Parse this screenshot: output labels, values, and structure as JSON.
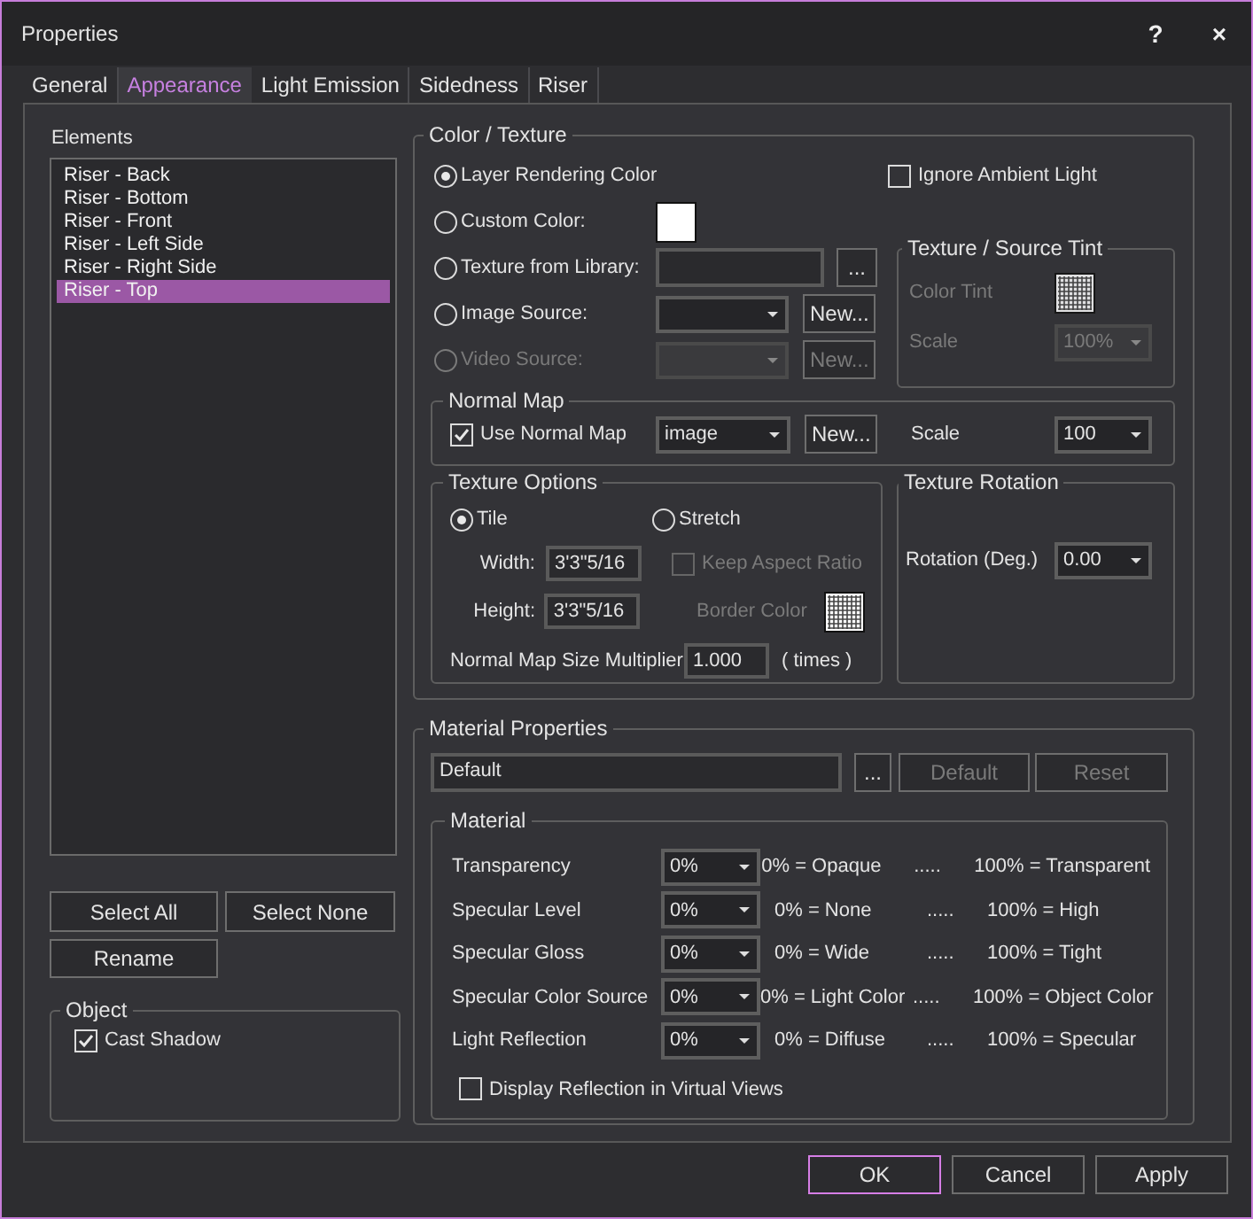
{
  "window": {
    "title": "Properties",
    "help": "?",
    "close": "×"
  },
  "tabs": [
    {
      "label": "General",
      "selected": false
    },
    {
      "label": "Appearance",
      "selected": true
    },
    {
      "label": "Light Emission",
      "selected": false
    },
    {
      "label": "Sidedness",
      "selected": false
    },
    {
      "label": "Riser",
      "selected": false
    }
  ],
  "elements": {
    "title": "Elements",
    "items": [
      {
        "label": "Riser - Back",
        "selected": false
      },
      {
        "label": "Riser - Bottom",
        "selected": false
      },
      {
        "label": "Riser - Front",
        "selected": false
      },
      {
        "label": "Riser - Left Side",
        "selected": false
      },
      {
        "label": "Riser - Right Side",
        "selected": false
      },
      {
        "label": "Riser - Top",
        "selected": true
      }
    ],
    "buttons": [
      "Select All",
      "Select None",
      "Rename"
    ]
  },
  "object": {
    "title": "Object",
    "cast_shadow": {
      "label": "Cast Shadow",
      "checked": true
    }
  },
  "color_texture": {
    "title": "Color / Texture",
    "options": [
      {
        "kind": "plain",
        "label": "Layer Rendering Color",
        "selected": true,
        "disabled": false
      },
      {
        "kind": "color",
        "label": "Custom Color:",
        "selected": false,
        "disabled": false
      },
      {
        "kind": "field",
        "label": "Texture from Library:",
        "selected": false,
        "disabled": false,
        "button": "..."
      },
      {
        "kind": "select",
        "label": "Image Source:",
        "selected": false,
        "disabled": false,
        "button": "New..."
      },
      {
        "kind": "select",
        "label": "Video Source:",
        "selected": false,
        "disabled": true,
        "button": "New..."
      }
    ],
    "ignore_ambient": {
      "label": "Ignore Ambient Light",
      "checked": false
    },
    "tint": {
      "title": "Texture / Source Tint",
      "disabled": true,
      "color_label": "Color Tint",
      "scale_label": "Scale",
      "scale_value": "100%"
    },
    "normal_map": {
      "title": "Normal Map",
      "use": {
        "label": "Use Normal Map",
        "checked": true
      },
      "source": "image",
      "button": "New...",
      "scale_label": "Scale",
      "scale_value": "100"
    },
    "texture_options": {
      "title": "Texture Options",
      "modes": [
        {
          "label": "Tile",
          "selected": true
        },
        {
          "label": "Stretch",
          "selected": false
        }
      ],
      "width_label": "Width:",
      "width_value": "3'3\"5/16",
      "height_label": "Height:",
      "height_value": "3'3\"5/16",
      "keep_aspect": {
        "label": "Keep Aspect Ratio",
        "checked": false,
        "disabled": true
      },
      "border_color_label": "Border Color",
      "multiplier_label": "Normal Map Size Multiplier",
      "multiplier_value": "1.000",
      "multiplier_unit": "( times )"
    },
    "rotation": {
      "title": "Texture Rotation",
      "label": "Rotation (Deg.)",
      "value": "0.00"
    }
  },
  "material_properties": {
    "title": "Material Properties",
    "name": "Default",
    "browse": "...",
    "buttons": [
      {
        "label": "Default",
        "disabled": true
      },
      {
        "label": "Reset",
        "disabled": true
      }
    ],
    "material": {
      "title": "Material",
      "rows": [
        {
          "label": "Transparency",
          "value": "0%",
          "low": "0% = Opaque",
          "dots": ".....",
          "high": "100% = Transparent"
        },
        {
          "label": "Specular Level",
          "value": "0%",
          "low": "0% = None",
          "dots": ".....",
          "high": "100% = High"
        },
        {
          "label": "Specular Gloss",
          "value": "0%",
          "low": "0% = Wide",
          "dots": ".....",
          "high": "100% = Tight"
        },
        {
          "label": "Specular Color Source",
          "value": "0%",
          "low": "0% = Light Color",
          "dots": ".....",
          "high": "100% = Object Color"
        },
        {
          "label": "Light Reflection",
          "value": "0%",
          "low": "0% = Diffuse",
          "dots": ".....",
          "high": "100% = Specular"
        }
      ],
      "display_reflection": {
        "label": "Display Reflection in Virtual Views",
        "checked": false
      }
    }
  },
  "footer": [
    {
      "label": "OK",
      "default": true
    },
    {
      "label": "Cancel",
      "default": false
    },
    {
      "label": "Apply",
      "default": false
    }
  ]
}
